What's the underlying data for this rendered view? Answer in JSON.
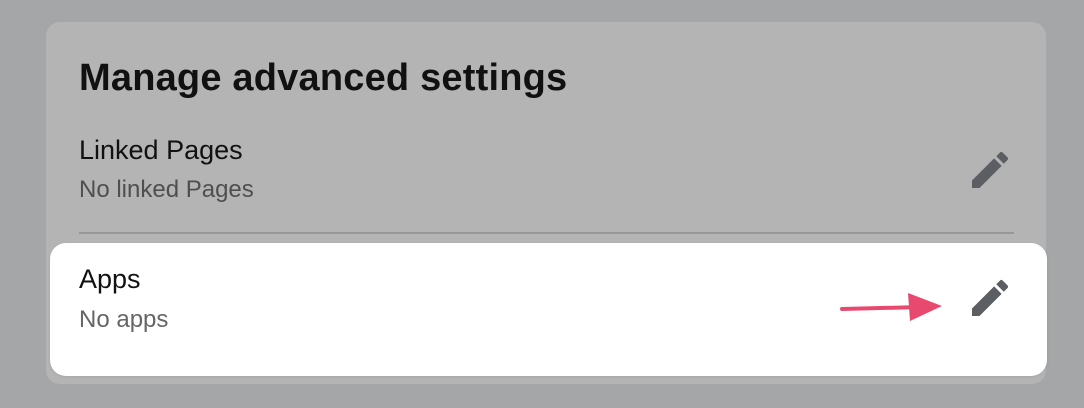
{
  "section": {
    "title": "Manage advanced settings"
  },
  "rows": [
    {
      "label": "Linked Pages",
      "sublabel": "No linked Pages",
      "icon": "pencil-icon"
    },
    {
      "label": "Apps",
      "sublabel": "No apps",
      "icon": "pencil-icon"
    }
  ],
  "colors": {
    "background": "#a5a6a7",
    "card": "#b4b4b4",
    "highlight_panel": "#ffffff",
    "icon": "#5b5e62",
    "arrow": "#e84a6f"
  }
}
